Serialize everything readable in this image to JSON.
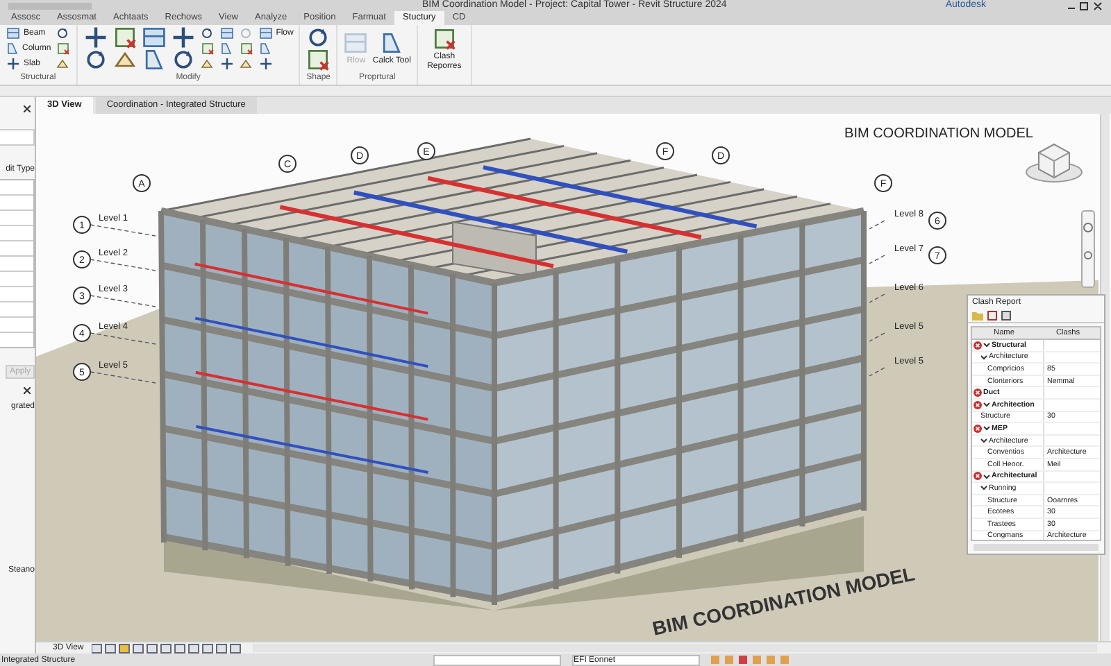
{
  "window": {
    "title": "BIM Coordination Model - Project: Capital Tower - Revit Structure 2024",
    "account": "Autodesk"
  },
  "ribbon_tabs": [
    {
      "label": "Assosc",
      "selected": false
    },
    {
      "label": "Assosmat",
      "selected": false
    },
    {
      "label": "Achtaats",
      "selected": false
    },
    {
      "label": "Rechows",
      "selected": false
    },
    {
      "label": "View",
      "selected": false
    },
    {
      "label": "Analyze",
      "selected": false
    },
    {
      "label": "Position",
      "selected": false
    },
    {
      "label": "Farmuat",
      "selected": false
    },
    {
      "label": "Stuctury",
      "selected": true
    },
    {
      "label": "CD",
      "selected": false
    }
  ],
  "ribbon_panels": [
    {
      "title": "Structural",
      "tools": [
        {
          "kind": "small",
          "label": "Beam",
          "disabled": false
        },
        {
          "kind": "small",
          "label": "Column",
          "disabled": false
        },
        {
          "kind": "small",
          "label": "Slab",
          "disabled": false
        },
        {
          "kind": "small",
          "disabled": false
        },
        {
          "kind": "small",
          "disabled": false
        },
        {
          "kind": "small",
          "disabled": false
        }
      ]
    },
    {
      "title": "Modify",
      "tools": [
        {
          "kind": "medium",
          "disabled": false
        },
        {
          "kind": "medium",
          "disabled": false
        },
        {
          "kind": "medium",
          "disabled": false
        },
        {
          "kind": "medium",
          "disabled": false
        },
        {
          "kind": "medium",
          "disabled": false
        },
        {
          "kind": "medium",
          "disabled": false
        },
        {
          "kind": "medium",
          "disabled": false
        },
        {
          "kind": "medium",
          "disabled": false
        },
        {
          "kind": "small",
          "disabled": false
        },
        {
          "kind": "small",
          "disabled": false
        },
        {
          "kind": "small",
          "disabled": false
        },
        {
          "kind": "small",
          "disabled": false
        },
        {
          "kind": "small",
          "disabled": false
        },
        {
          "kind": "small",
          "disabled": false
        },
        {
          "kind": "small",
          "disabled": true
        },
        {
          "kind": "small",
          "disabled": false
        },
        {
          "kind": "small",
          "disabled": false
        },
        {
          "kind": "small",
          "label": "Flow",
          "disabled": false
        },
        {
          "kind": "small",
          "disabled": false
        },
        {
          "kind": "small",
          "disabled": false
        }
      ]
    },
    {
      "title": "Shape",
      "tools": [
        {
          "kind": "medium",
          "disabled": false
        },
        {
          "kind": "medium",
          "disabled": false
        }
      ]
    },
    {
      "title": "Proprtural",
      "tools": [
        {
          "kind": "large",
          "label": "Rlow",
          "disabled": true
        },
        {
          "kind": "large",
          "label": "Calck Tool",
          "disabled": false
        }
      ]
    },
    {
      "tools": [
        {
          "kind": "large",
          "label": "Clash Reporres",
          "disabled": false
        }
      ]
    }
  ],
  "properties": {
    "edit_type": "dit Type",
    "apply": {
      "label": "Apply",
      "disabled": true
    }
  },
  "project_browser": {
    "items": [
      "grated",
      "Steano"
    ]
  },
  "view_tabs": [
    {
      "label": "3D View",
      "selected": true
    },
    {
      "label": "Coordination - Integrated Structure",
      "selected": false
    }
  ],
  "viewport": {
    "title": "BIM COORDINATION MODEL",
    "ground_text": "BIM COORDINATION MODEL",
    "grid_bubbles": [
      "A",
      "C",
      "D",
      "E",
      "F",
      "D",
      "F"
    ],
    "level_markers": [
      {
        "label": "Level 1",
        "number": "1"
      },
      {
        "label": "Level 2",
        "number": "2"
      },
      {
        "label": "Level 3",
        "number": "3"
      },
      {
        "label": "Level 4",
        "number": "4"
      },
      {
        "label": "Level 5",
        "number": "5"
      },
      {
        "label": "Level 8",
        "number": "6"
      },
      {
        "label": "Level 7",
        "number": "7"
      },
      {
        "label": "Level 6"
      },
      {
        "label": "Level 5"
      },
      {
        "label": "Level 5"
      }
    ]
  },
  "clash_report": {
    "title": "Clash Report",
    "columns": [
      "Name",
      "Clashs"
    ],
    "rows": [
      {
        "name": "Structural",
        "flag": true,
        "expanded": true,
        "children": [
          {
            "name": "Architecture",
            "expanded": true,
            "children": [
              {
                "name": "Compricios",
                "value": "85"
              },
              {
                "name": "Clonteriors",
                "value": "Nemmal"
              }
            ]
          }
        ]
      },
      {
        "name": "Duct",
        "flag": true
      },
      {
        "name": "Architection",
        "flag": true,
        "expanded": true,
        "children": [
          {
            "name": "Structure",
            "value": "30"
          }
        ]
      },
      {
        "name": "MEP",
        "flag": true,
        "expanded": true,
        "children": [
          {
            "name": "Architecture",
            "expanded": true,
            "children": [
              {
                "name": "Conventios",
                "value": "Architecture"
              },
              {
                "name": "Coll Heoor.",
                "value": "Meil"
              }
            ]
          }
        ]
      },
      {
        "name": "Architectural",
        "flag": true,
        "expanded": true,
        "children": [
          {
            "name": "Running",
            "expanded": true,
            "children": [
              {
                "name": "Structure",
                "value": "Ooarnres"
              },
              {
                "name": "Ecotees",
                "value": "30"
              },
              {
                "name": "Trastees",
                "value": "30"
              },
              {
                "name": "Congmans",
                "value": "Architecture"
              }
            ]
          }
        ]
      }
    ]
  },
  "view_bar": {
    "label": "3D View"
  },
  "status_bar": {
    "text": "Integrated Structure",
    "workset": "EFI Eonnet"
  }
}
